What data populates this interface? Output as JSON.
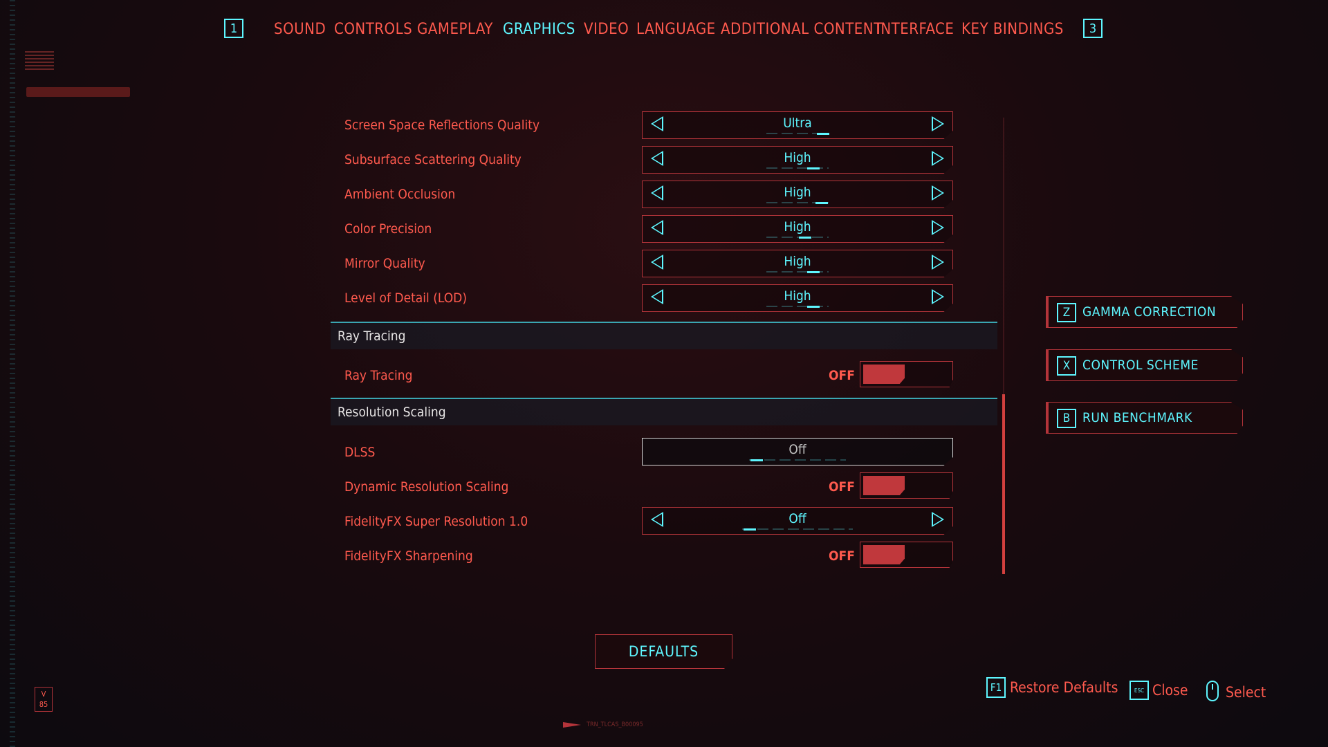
{
  "nav": {
    "left_key": "1",
    "right_key": "3",
    "tabs": [
      "SOUND",
      "CONTROLS",
      "GAMEPLAY",
      "GRAPHICS",
      "VIDEO",
      "LANGUAGE",
      "ADDITIONAL CONTENT",
      "INTERFACE",
      "KEY BINDINGS"
    ],
    "active_tab": "GRAPHICS"
  },
  "settings": {
    "ssr": {
      "label": "Screen Space Reflections Quality",
      "value": "Ultra"
    },
    "sss": {
      "label": "Subsurface Scattering Quality",
      "value": "High"
    },
    "ao": {
      "label": "Ambient Occlusion",
      "value": "High"
    },
    "color_precision": {
      "label": "Color Precision",
      "value": "High"
    },
    "mirror": {
      "label": "Mirror Quality",
      "value": "High"
    },
    "lod": {
      "label": "Level of Detail (LOD)",
      "value": "High"
    }
  },
  "ray_tracing_section": {
    "title": "Ray Tracing",
    "ray_tracing": {
      "label": "Ray Tracing",
      "state": "OFF"
    }
  },
  "resolution_section": {
    "title": "Resolution Scaling",
    "dlss": {
      "label": "DLSS",
      "value": "Off"
    },
    "dynamic": {
      "label": "Dynamic Resolution Scaling",
      "state": "OFF"
    },
    "fsr": {
      "label": "FidelityFX Super Resolution 1.0",
      "value": "Off"
    },
    "sharpening": {
      "label": "FidelityFX Sharpening",
      "state": "OFF"
    }
  },
  "actions": {
    "gamma": {
      "key": "Z",
      "label": "GAMMA CORRECTION"
    },
    "control": {
      "key": "X",
      "label": "CONTROL SCHEME"
    },
    "benchmark": {
      "key": "B",
      "label": "RUN BENCHMARK"
    }
  },
  "defaults_button": "DEFAULTS",
  "hints": {
    "restore": {
      "key": "F1",
      "label": "Restore Defaults"
    },
    "close": {
      "key": "ESC",
      "label": "Close"
    },
    "select": {
      "label": "Select"
    }
  },
  "footer": {
    "badge_top": "V",
    "badge_bottom": "85",
    "code": "TRN_TLCAS_B00095"
  },
  "colors": {
    "accent_red": "#ff5a4e",
    "accent_cyan": "#5ef6ff",
    "toggle_off": "#c0383c"
  }
}
